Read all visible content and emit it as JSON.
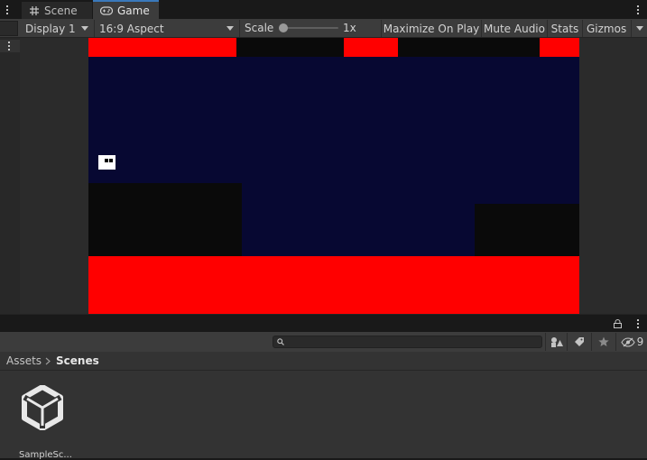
{
  "tabs": [
    {
      "label": "Scene",
      "icon": "hash-grid-icon",
      "active": false
    },
    {
      "label": "Game",
      "icon": "gamepad-icon",
      "active": true
    }
  ],
  "toolbar": {
    "display": "Display 1",
    "aspect": "16:9 Aspect",
    "scale_label": "Scale",
    "scale_value": "1x",
    "scale_level": 0.0,
    "maximize": "Maximize On Play",
    "mute": "Mute Audio",
    "stats": "Stats",
    "gizmos": "Gizmos"
  },
  "game": {
    "background": "#070832",
    "hazard_color": "#ff0000",
    "platform_color": "#0a0a0a",
    "player_color": "#ffffff"
  },
  "project": {
    "search_placeholder": "",
    "hidden_count": "9",
    "breadcrumb": [
      "Assets",
      "Scenes"
    ],
    "items": [
      {
        "name": "SampleSc...",
        "icon": "unity-logo-icon"
      }
    ]
  },
  "colors": {
    "accent": "#3a79bb",
    "panel": "#3c3c3c",
    "dark": "#191919"
  }
}
